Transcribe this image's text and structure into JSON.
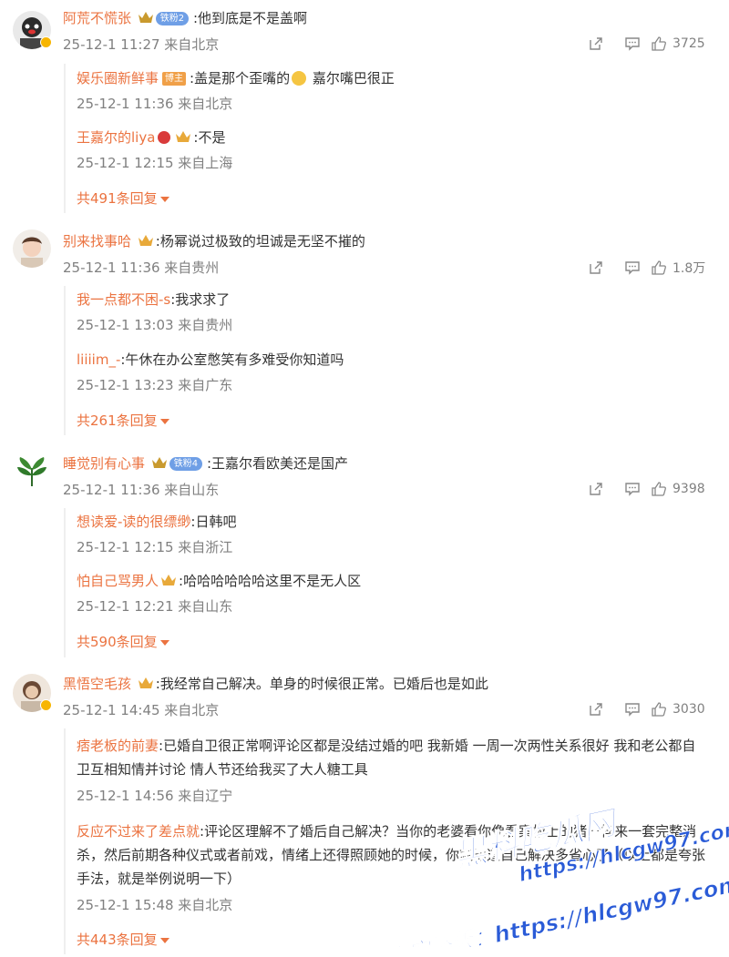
{
  "comments": [
    {
      "user": "阿荒不慌张",
      "fan_badge": "铁粉2",
      "text": ":他到底是不是盖啊",
      "meta": "25-12-1 11:27 来自北京",
      "likes": "3725",
      "replies": [
        {
          "user": "娱乐圈新鲜事",
          "tag": "博主",
          "text": ":盖是那个歪嘴的",
          "text_after": " 嘉尔嘴巴很正",
          "meta": "25-12-1 11:36 来自北京"
        },
        {
          "user": "王嘉尔的liya",
          "text": ":不是",
          "meta": "25-12-1 12:15 来自上海"
        }
      ],
      "more": "共491条回复"
    },
    {
      "user": "别来找事哈",
      "text": ":杨幂说过极致的坦诚是无坚不摧的",
      "meta": "25-12-1 11:36 来自贵州",
      "likes": "1.8万",
      "replies": [
        {
          "user": "我一点都不困-s",
          "text": ":我求求了",
          "meta": "25-12-1 13:03 来自贵州"
        },
        {
          "user": "liiiim_-",
          "text": ":午休在办公室憋笑有多难受你知道吗",
          "meta": "25-12-1 13:23 来自广东"
        }
      ],
      "more": "共261条回复"
    },
    {
      "user": "睡觉别有心事",
      "fan_badge": "铁粉4",
      "text": ":王嘉尔看欧美还是国产",
      "meta": "25-12-1 11:36 来自山东",
      "likes": "9398",
      "replies": [
        {
          "user": "想读爱-读的很缥缈",
          "text": ":日韩吧",
          "meta": "25-12-1 12:15 来自浙江"
        },
        {
          "user": "怕自己骂男人",
          "text": ":哈哈哈哈哈哈这里不是无人区",
          "meta": "25-12-1 12:21 来自山东"
        }
      ],
      "more": "共590条回复"
    },
    {
      "user": "黑悟空毛孩",
      "text": ":我经常自己解决。单身的时候很正常。已婚后也是如此",
      "meta": "25-12-1 14:45 来自北京",
      "likes": "3030",
      "replies": [
        {
          "user": "痞老板的前妻",
          "text": ":已婚自卫很正常啊评论区都是没结过婚的吧  我新婚 一周一次两性关系很好  我和老公都自卫互相知情并讨论  情人节还给我买了大人糖工具",
          "meta": "25-12-1 14:56 来自辽宁"
        },
        {
          "user": "反应不过来了差点就",
          "text": ":评论区理解不了婚后自己解决？当你的老婆看你像看案板上的猪一样来一套完整消杀，然后前期各种仪式或者前戏，情绪上还得照顾她的时候，你就知道自己解决多省心了（以上都是夸张手法，就是举例说明一下）",
          "meta": "25-12-1 15:48 来自北京"
        }
      ],
      "more": "共443条回复"
    }
  ],
  "watermark": {
    "line1": "黑料吃瓜网",
    "line2": "https://hlcgw97.com",
    "line3": "看完整版：https://hlcgw97.com"
  },
  "colors": {
    "username": "#eb7340",
    "meta": "#808080",
    "text": "#333333",
    "watermark": "#2a5bd7"
  }
}
